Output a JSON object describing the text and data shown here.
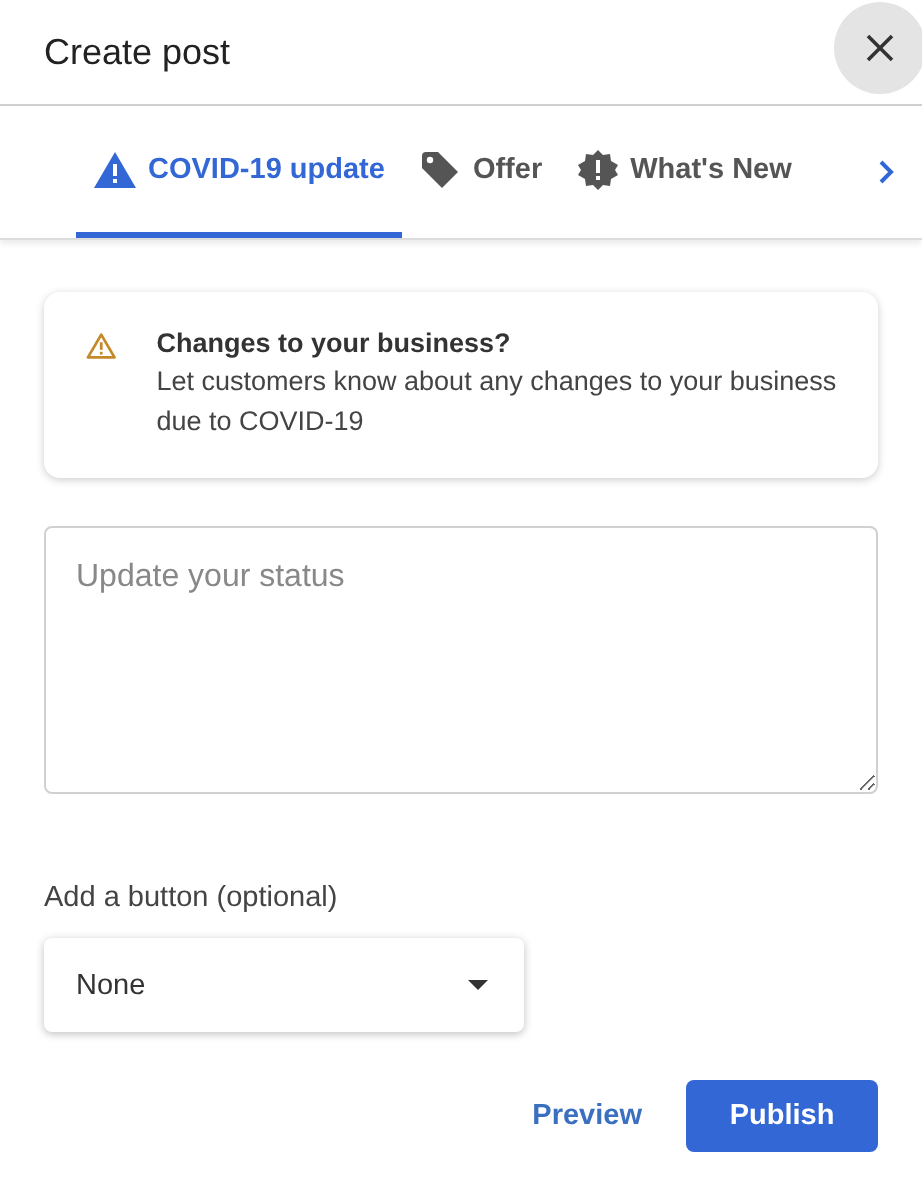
{
  "dialog": {
    "title": "Create post"
  },
  "tabs": [
    {
      "label": "COVID-19 update",
      "kind": "warning",
      "selected": true
    },
    {
      "label": "Offer",
      "kind": "tag",
      "selected": false
    },
    {
      "label": "What's New",
      "kind": "news",
      "selected": false
    }
  ],
  "notice": {
    "title": "Changes to your business?",
    "text": "Let customers know about any changes to your business due to COVID-19"
  },
  "status_field": {
    "placeholder": "Update your status"
  },
  "button_select": {
    "label": "Add a button (optional)",
    "value": "None"
  },
  "actions": {
    "secondary": "Preview",
    "primary": "Publish"
  }
}
